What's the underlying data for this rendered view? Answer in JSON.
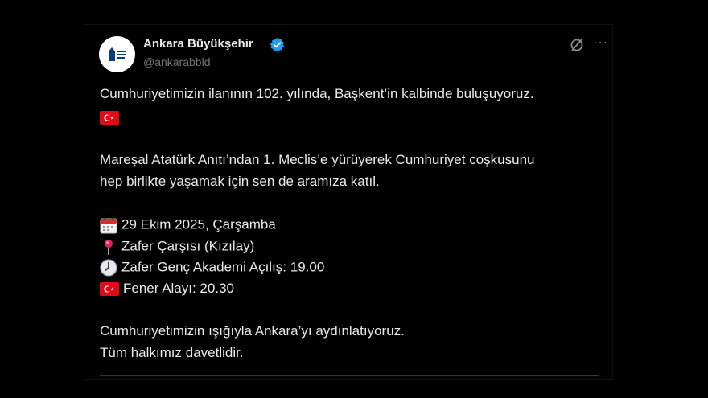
{
  "author": {
    "name": "Ankara Büyükşehir",
    "handle": "@ankarabbld",
    "verified_icon": "verified-badge-icon",
    "avatar_icon": "ankara-logo-icon"
  },
  "actions": {
    "grok_icon": "grok-icon",
    "more_label": "···"
  },
  "post": {
    "line1": "Cumhuriyetimizin ilanının 102. yılında, Başkent’in kalbinde buluşuyoruz.",
    "flag_icon": "turkey-flag-icon",
    "line3": "Mareşal Atatürk Anıtı’ndan 1. Meclis’e yürüyerek Cumhuriyet coşkusunu",
    "line4": "hep birlikte yaşamak için sen de aramıza katıl.",
    "date": "29 Ekim 2025, Çarşamba",
    "location": "Zafer Çarşısı (Kızılay)",
    "opening": "Zafer Genç Akademi Açılış: 19.00",
    "parade": "Fener Alayı: 20.30",
    "closing1": "Cumhuriyetimizin ışığıyla Ankara’yı aydınlatıyoruz.",
    "closing2": "Tüm halkımız davetlidir."
  },
  "colors": {
    "background": "#000000",
    "text": "#e7e9ea",
    "muted": "#71767b",
    "verified": "#1d9bf0",
    "flag": "#e30a17"
  }
}
